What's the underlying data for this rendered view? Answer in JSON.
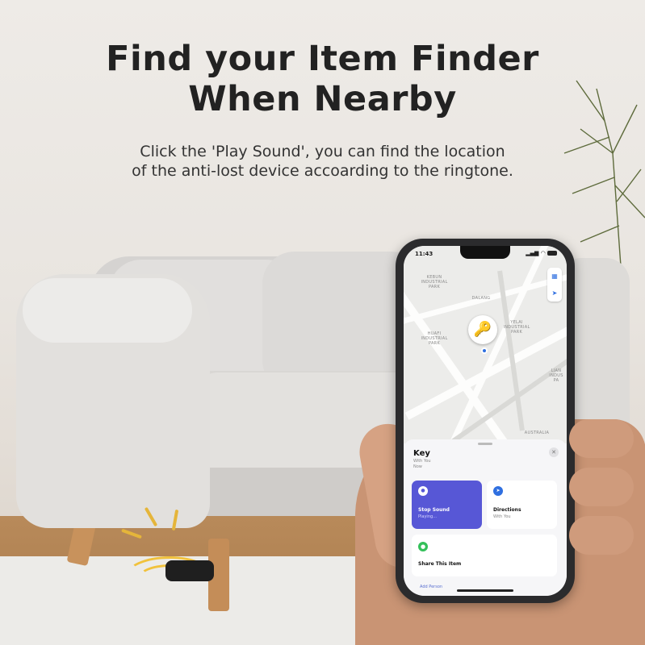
{
  "headline": {
    "line1": "Find your Item Finder",
    "line2": "When Nearby"
  },
  "subline": {
    "line1": "Click the 'Play Sound', you can find the location",
    "line2": "of the anti-lost device accoarding to the ringtone."
  },
  "phone": {
    "status_time": "11:43",
    "map_labels": {
      "kebun": "KEBUN\nINDUSTRIAL\nPARK",
      "dalang": "DALANG",
      "huafi": "HUAFI\nINDUSTRIAL\nPARK",
      "yelai": "YELAI\nINDUSTRIAL\nPARK",
      "lian": "LIAN\nINDUS\nPA",
      "australia": "AUSTRALIA"
    },
    "pin_icon": "key-icon",
    "item": {
      "title": "Key",
      "subtitle": "With You",
      "status": "Now"
    },
    "actions": {
      "play": {
        "label": "Stop Sound",
        "sub": "Playing..."
      },
      "directions": {
        "label": "Directions",
        "sub": "With You"
      }
    },
    "share": {
      "label": "Share This Item"
    },
    "add_person": "Add Person"
  },
  "colors": {
    "accent": "#5757d6",
    "pin": "#d6a419",
    "share": "#34c05a"
  }
}
